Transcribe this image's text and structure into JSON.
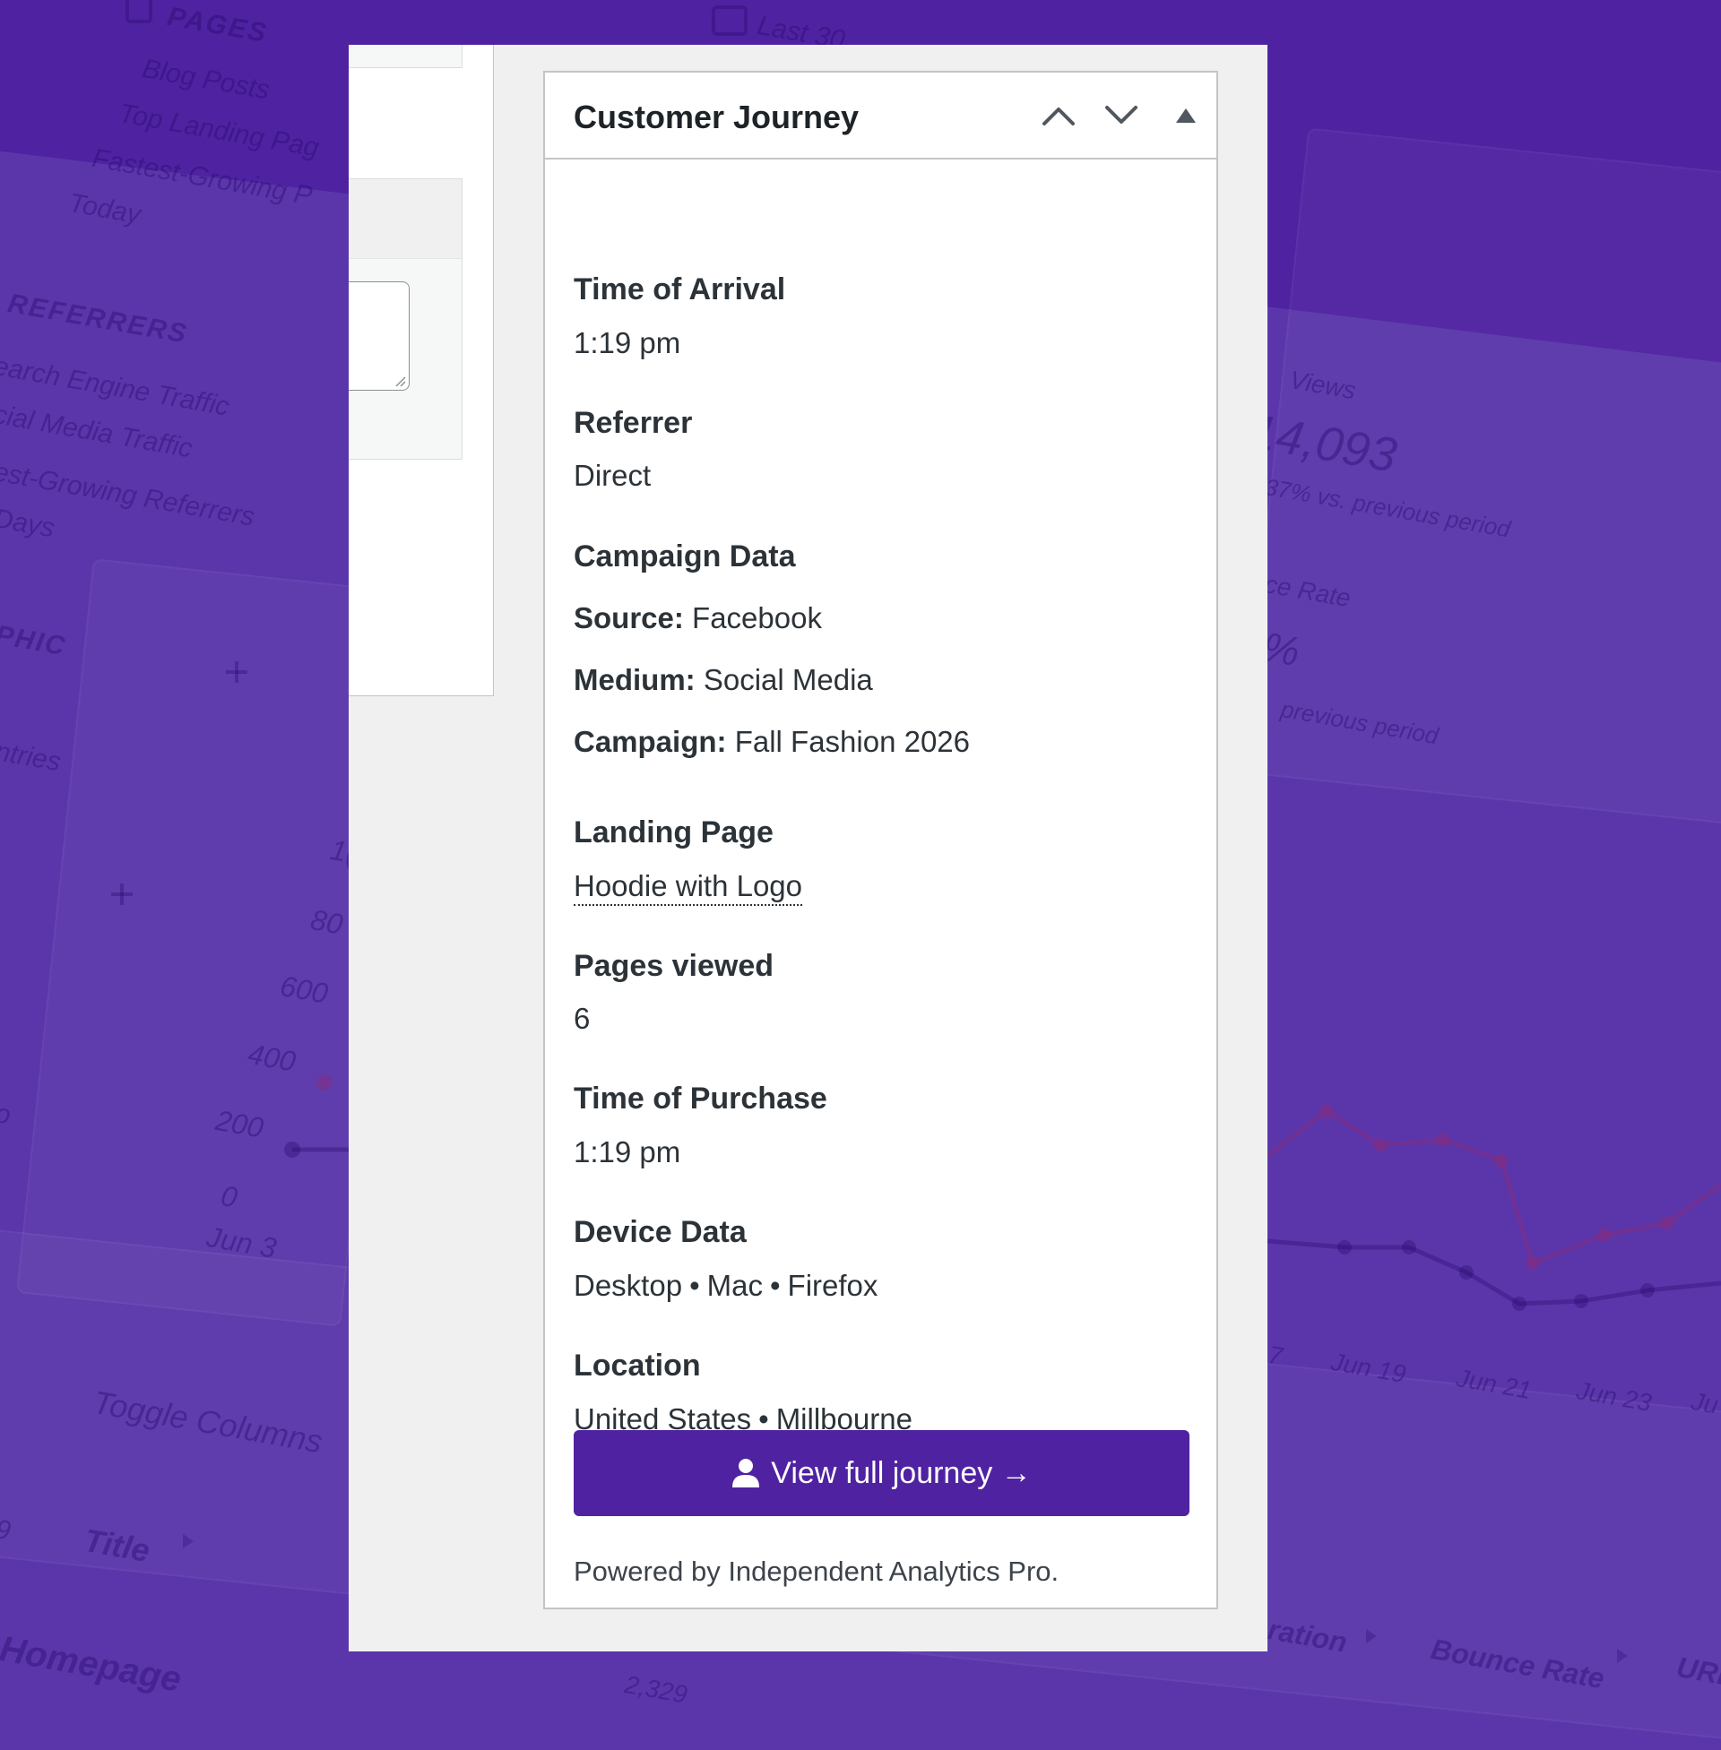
{
  "background": {
    "pages_heading": "PAGES",
    "pages_items": [
      "Blog Posts",
      "Top Landing Pag",
      "Fastest-Growing P",
      "Today"
    ],
    "referrers_heading": "REFERRERS",
    "referrers_items": [
      "earch Engine Traffic",
      "cial Media Traffic",
      "est-Growing Referrers",
      "Days"
    ],
    "geo_heading": "PHIC",
    "geo_item": "ntries",
    "date_range": "Last 30 ",
    "views_label": "Views",
    "views_value": "14,093",
    "views_change": "37% vs. previous period",
    "bounce_label": "ce Rate",
    "bounce_value": "%",
    "bounce_change": "previous period",
    "y_ticks": [
      "1(",
      "80",
      "600",
      "400",
      "200",
      "0"
    ],
    "x_ticks_left": [
      "Jun 3"
    ],
    "x_ticks_right": [
      "7",
      "Jun 19",
      "Jun 21",
      "Jun 23",
      "Ju"
    ],
    "toggle_columns": "Toggle Columns",
    "col_title": "Title",
    "col_duration": "ration",
    "col_bounce": "Bounce Rate",
    "col_url": "URL",
    "row_homepage": "Homepage",
    "row_value": "2,329",
    "left_cut": "o",
    "left_cut_2": "9"
  },
  "widget": {
    "title": "Customer Journey",
    "controls": {
      "move_up": "chevron-up-icon",
      "move_down": "chevron-down-icon",
      "toggle": "triangle-up-icon"
    },
    "time_of_arrival": {
      "label": "Time of Arrival",
      "value": "1:19 pm"
    },
    "referrer": {
      "label": "Referrer",
      "value": "Direct"
    },
    "campaign": {
      "label": "Campaign Data",
      "source_label": "Source:",
      "source_value": "Facebook",
      "medium_label": "Medium:",
      "medium_value": "Social Media",
      "campaign_label": "Campaign:",
      "campaign_value": "Fall Fashion 2026"
    },
    "landing_page": {
      "label": "Landing Page",
      "value": "Hoodie with Logo"
    },
    "pages_viewed": {
      "label": "Pages viewed",
      "value": "6"
    },
    "time_of_purchase": {
      "label": "Time of Purchase",
      "value": "1:19 pm"
    },
    "device": {
      "label": "Device Data",
      "type": "Desktop",
      "os": "Mac",
      "browser": "Firefox",
      "separator": "•"
    },
    "location": {
      "label": "Location",
      "country": "United States",
      "city": "Millbourne",
      "separator": "•"
    },
    "button_label": "View full journey →",
    "button_icon": "user-icon",
    "footer": "Powered by Independent Analytics Pro."
  },
  "colors": {
    "background": "#5b36ab",
    "background_band": "#4f22a1",
    "accent": "#4f22a1",
    "text": "#2c3338",
    "border": "#c3c4c7"
  }
}
